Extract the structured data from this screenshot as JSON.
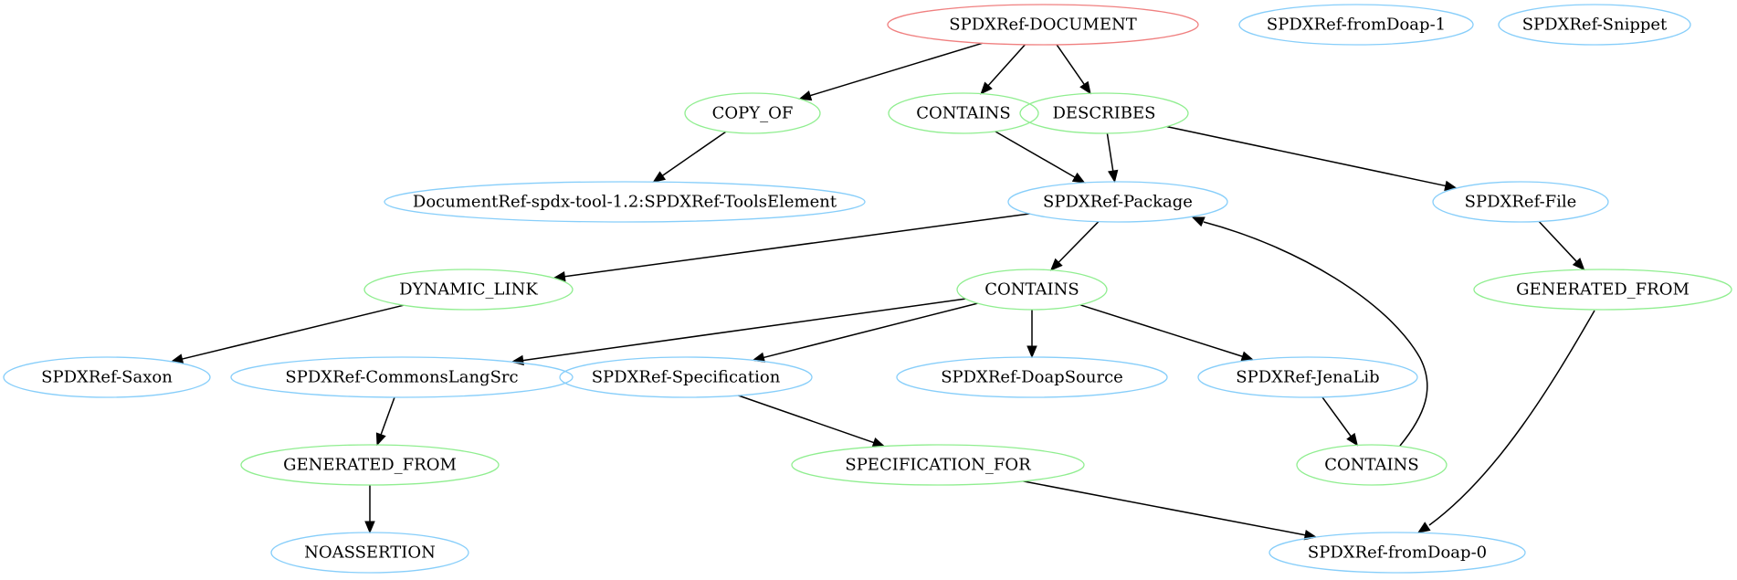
{
  "graph": {
    "colors": {
      "root": "#f08080",
      "element": "#87cefa",
      "relationship": "#90ee90",
      "edge": "#000000"
    },
    "nodes": [
      {
        "id": "doc",
        "label": "SPDXRef-DOCUMENT",
        "kind": "root"
      },
      {
        "id": "fromDoap1",
        "label": "SPDXRef-fromDoap-1",
        "kind": "element"
      },
      {
        "id": "snippet",
        "label": "SPDXRef-Snippet",
        "kind": "element"
      },
      {
        "id": "copyOf",
        "label": "COPY_OF",
        "kind": "relationship"
      },
      {
        "id": "contains1",
        "label": "CONTAINS",
        "kind": "relationship"
      },
      {
        "id": "describes",
        "label": "DESCRIBES",
        "kind": "relationship"
      },
      {
        "id": "toolsElement",
        "label": "DocumentRef-spdx-tool-1.2:SPDXRef-ToolsElement",
        "kind": "element"
      },
      {
        "id": "package",
        "label": "SPDXRef-Package",
        "kind": "element"
      },
      {
        "id": "file",
        "label": "SPDXRef-File",
        "kind": "element"
      },
      {
        "id": "dynamicLink",
        "label": "DYNAMIC_LINK",
        "kind": "relationship"
      },
      {
        "id": "contains2",
        "label": "CONTAINS",
        "kind": "relationship"
      },
      {
        "id": "generatedFrom1",
        "label": "GENERATED_FROM",
        "kind": "relationship"
      },
      {
        "id": "saxon",
        "label": "SPDXRef-Saxon",
        "kind": "element"
      },
      {
        "id": "commonsLang",
        "label": "SPDXRef-CommonsLangSrc",
        "kind": "element"
      },
      {
        "id": "specification",
        "label": "SPDXRef-Specification",
        "kind": "element"
      },
      {
        "id": "doapSource",
        "label": "SPDXRef-DoapSource",
        "kind": "element"
      },
      {
        "id": "jenaLib",
        "label": "SPDXRef-JenaLib",
        "kind": "element"
      },
      {
        "id": "generatedFrom2",
        "label": "GENERATED_FROM",
        "kind": "relationship"
      },
      {
        "id": "specFor",
        "label": "SPECIFICATION_FOR",
        "kind": "relationship"
      },
      {
        "id": "contains3",
        "label": "CONTAINS",
        "kind": "relationship"
      },
      {
        "id": "noAssertion",
        "label": "NOASSERTION",
        "kind": "element"
      },
      {
        "id": "fromDoap0",
        "label": "SPDXRef-fromDoap-0",
        "kind": "element"
      }
    ],
    "edges": [
      {
        "from": "doc",
        "to": "copyOf"
      },
      {
        "from": "doc",
        "to": "contains1"
      },
      {
        "from": "doc",
        "to": "describes"
      },
      {
        "from": "copyOf",
        "to": "toolsElement"
      },
      {
        "from": "contains1",
        "to": "package"
      },
      {
        "from": "describes",
        "to": "package"
      },
      {
        "from": "describes",
        "to": "file"
      },
      {
        "from": "package",
        "to": "dynamicLink"
      },
      {
        "from": "package",
        "to": "contains2"
      },
      {
        "from": "file",
        "to": "generatedFrom1"
      },
      {
        "from": "dynamicLink",
        "to": "saxon"
      },
      {
        "from": "contains2",
        "to": "commonsLang"
      },
      {
        "from": "contains2",
        "to": "specification"
      },
      {
        "from": "contains2",
        "to": "doapSource"
      },
      {
        "from": "contains2",
        "to": "jenaLib"
      },
      {
        "from": "commonsLang",
        "to": "generatedFrom2"
      },
      {
        "from": "specification",
        "to": "specFor"
      },
      {
        "from": "jenaLib",
        "to": "contains3"
      },
      {
        "from": "contains3",
        "to": "package"
      },
      {
        "from": "generatedFrom2",
        "to": "noAssertion"
      },
      {
        "from": "specFor",
        "to": "fromDoap0"
      },
      {
        "from": "generatedFrom1",
        "to": "fromDoap0"
      }
    ]
  }
}
